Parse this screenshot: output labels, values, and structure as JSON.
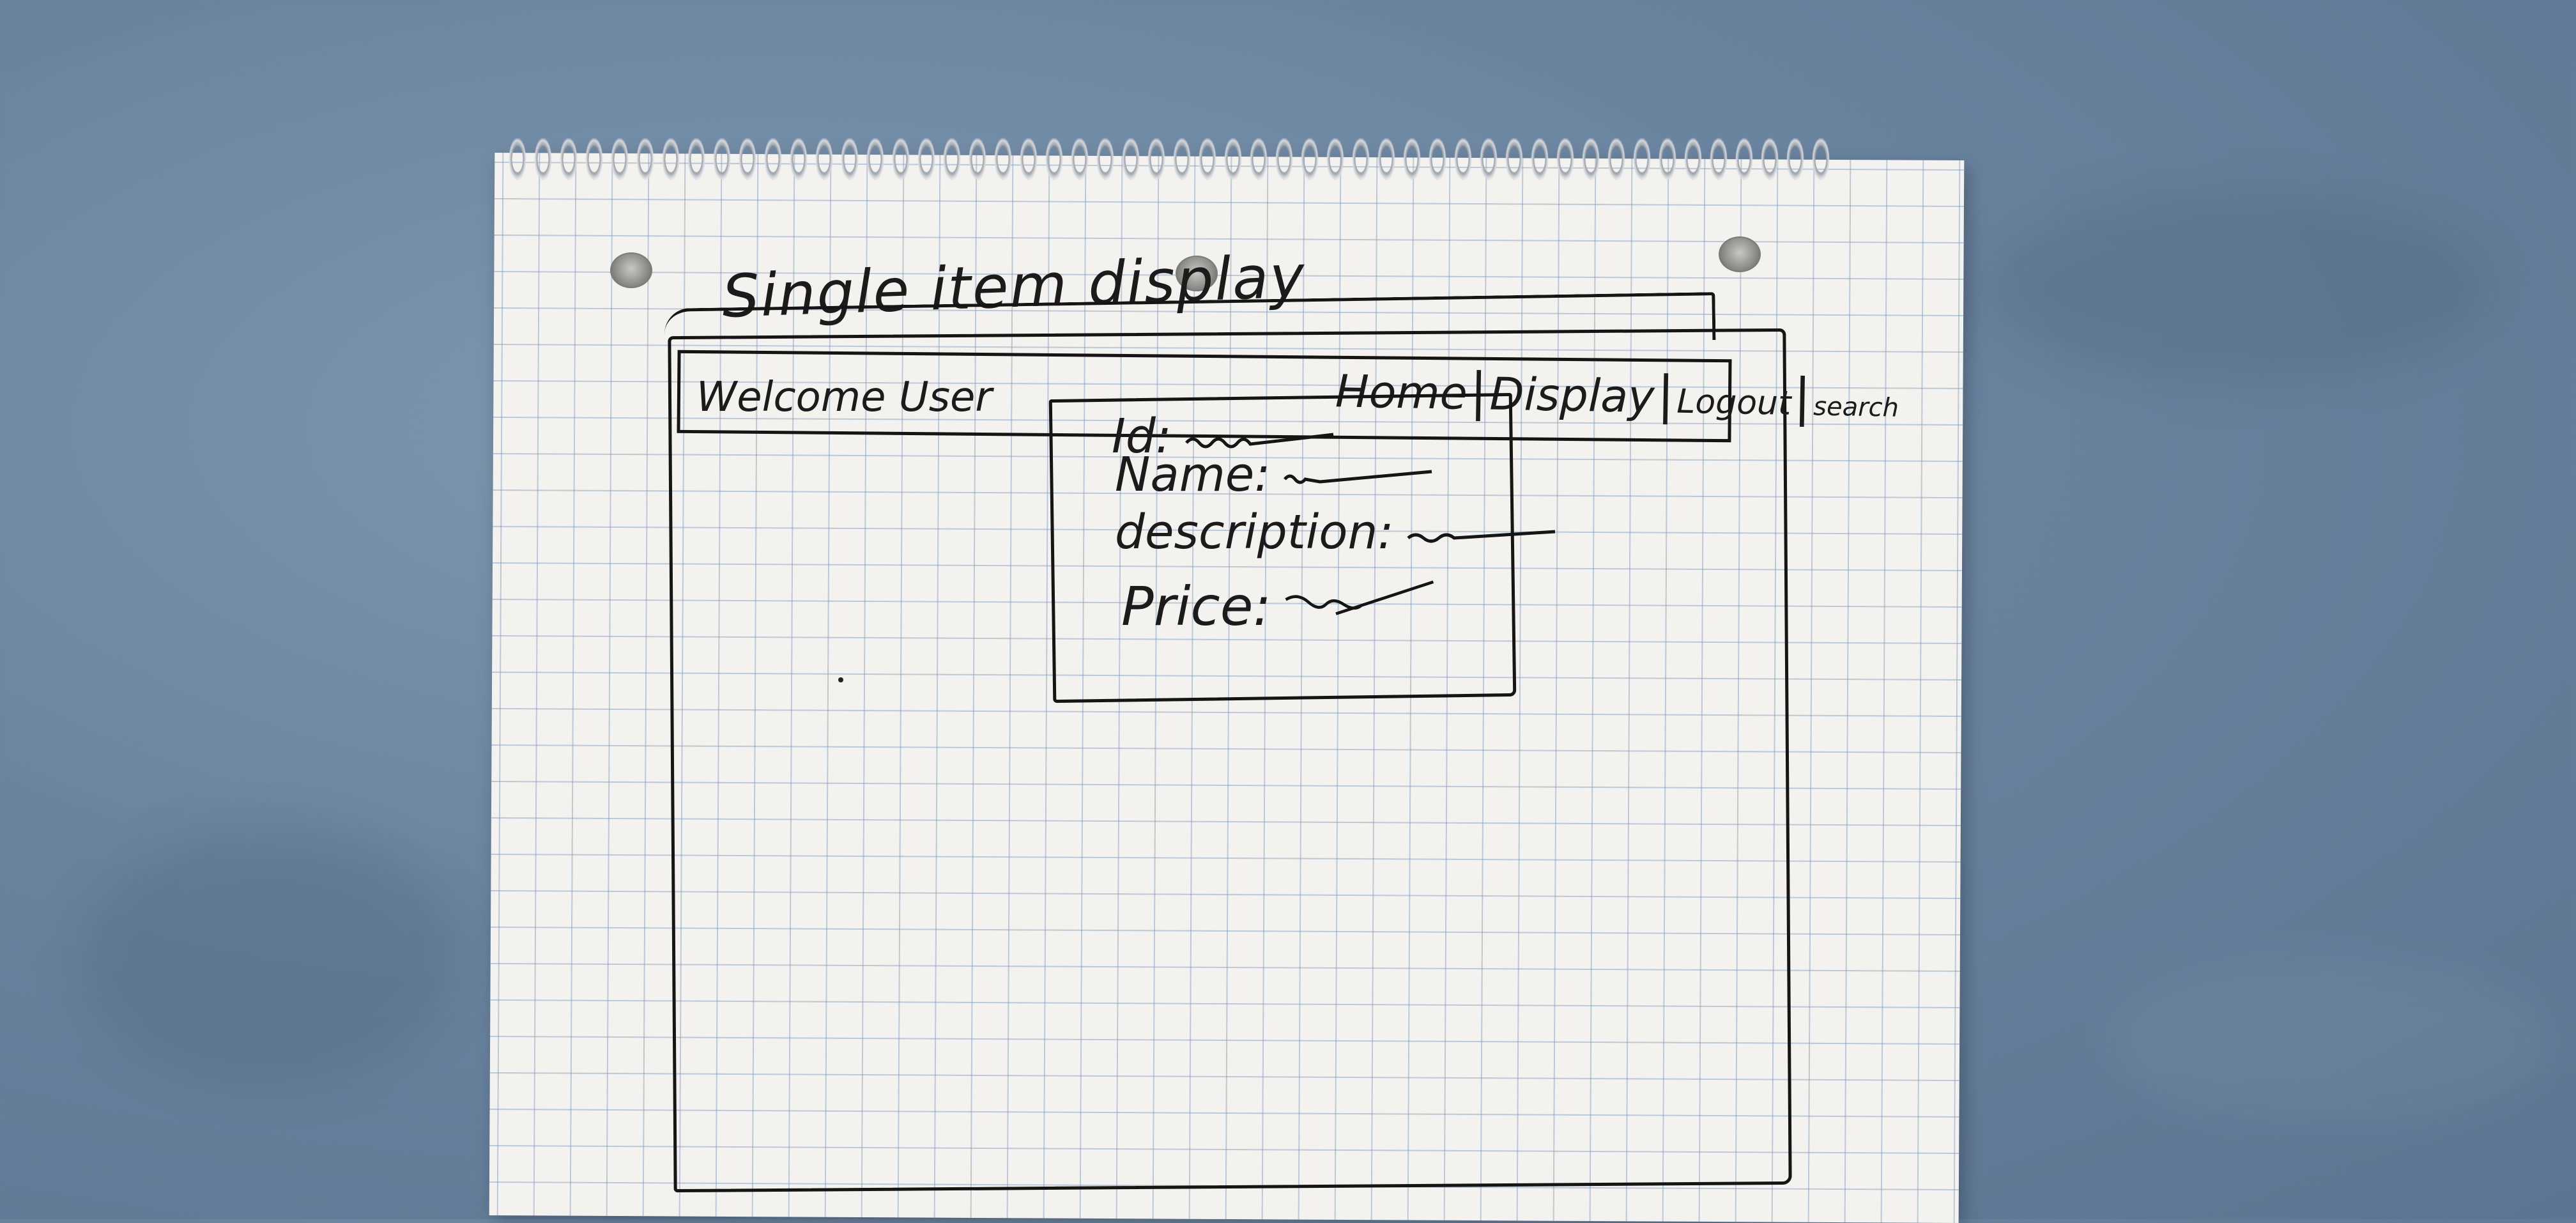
{
  "sketch": {
    "title": "Single item display",
    "nav": {
      "welcome": "Welcome User",
      "links": [
        "Home",
        "Display",
        "Logout",
        "search"
      ],
      "separator": "|"
    },
    "item_card": {
      "fields": [
        {
          "label": "Id:"
        },
        {
          "label": "Name:"
        },
        {
          "label": "description:"
        },
        {
          "label": "Price:"
        }
      ]
    }
  }
}
